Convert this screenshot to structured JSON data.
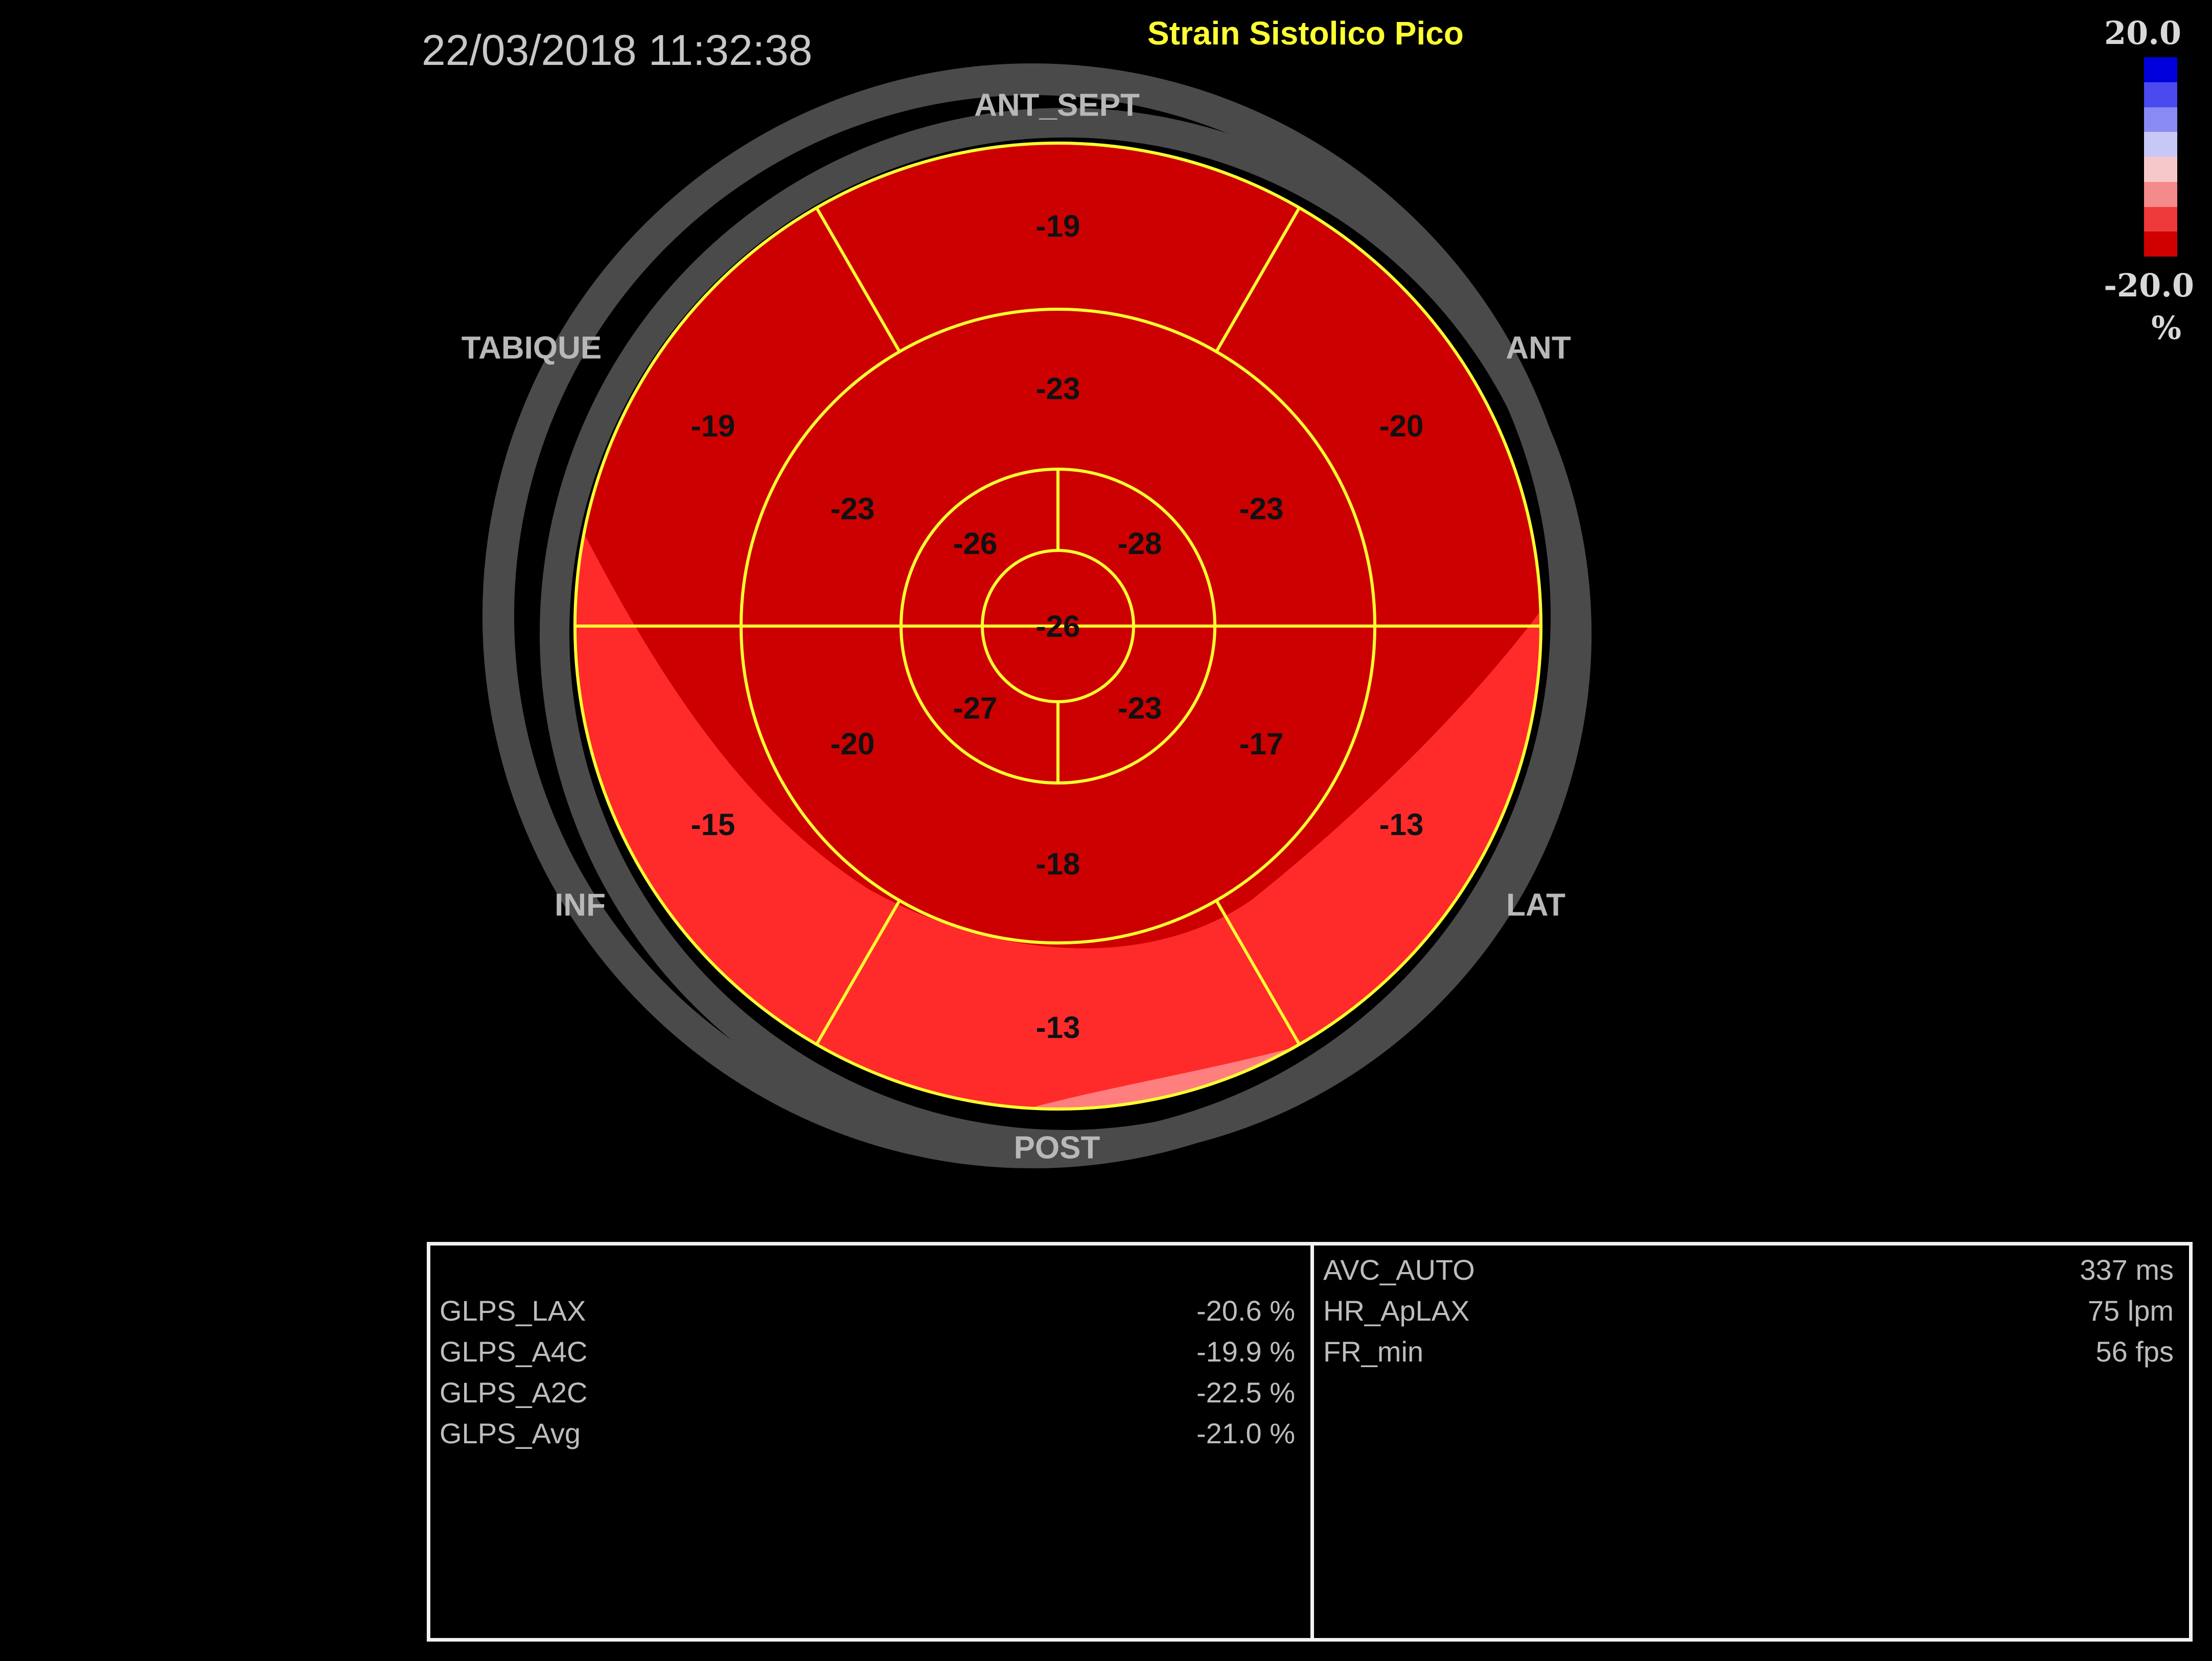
{
  "header": {
    "timestamp": "22/03/2018 11:32:38",
    "title": "Strain Sistolico Pico"
  },
  "scale": {
    "max_label": "20.0",
    "min_label": "-20.0",
    "unit": "%",
    "colors": [
      "#0000dd",
      "#4a4aee",
      "#8a8af5",
      "#c8c8f7",
      "#f7c8c8",
      "#f58a8a",
      "#ee3a3a",
      "#d00000"
    ]
  },
  "bullseye": {
    "wall_labels": {
      "ant_sept": "ANT_SEPT",
      "tabique": "TABIQUE",
      "ant": "ANT",
      "inf": "INF",
      "lat": "LAT",
      "post": "POST"
    },
    "basal": [
      "-19",
      "-20",
      "-13",
      "-13",
      "-15",
      "-19"
    ],
    "mid": [
      "-23",
      "-23",
      "-17",
      "-18",
      "-20",
      "-23"
    ],
    "apical": [
      "-28",
      "-23",
      "-27",
      "-26"
    ],
    "apex": "-26",
    "colors": {
      "deep_red": "#cc0000",
      "light_red": "#ff2b2b",
      "pink": "#ff7f7f",
      "border": "#ffff33",
      "ring": "#4a4a4a"
    }
  },
  "panel_left": {
    "rows": [
      {
        "label": "GLPS_LAX",
        "value": "-20.6 %"
      },
      {
        "label": "GLPS_A4C",
        "value": "-19.9 %"
      },
      {
        "label": "GLPS_A2C",
        "value": "-22.5 %"
      },
      {
        "label": "GLPS_Avg",
        "value": "-21.0 %"
      }
    ]
  },
  "panel_right": {
    "rows": [
      {
        "label": "AVC_AUTO",
        "value": "337 ms"
      },
      {
        "label": "HR_ApLAX",
        "value": "75 lpm"
      },
      {
        "label": "FR_min",
        "value": "56 fps"
      }
    ]
  }
}
